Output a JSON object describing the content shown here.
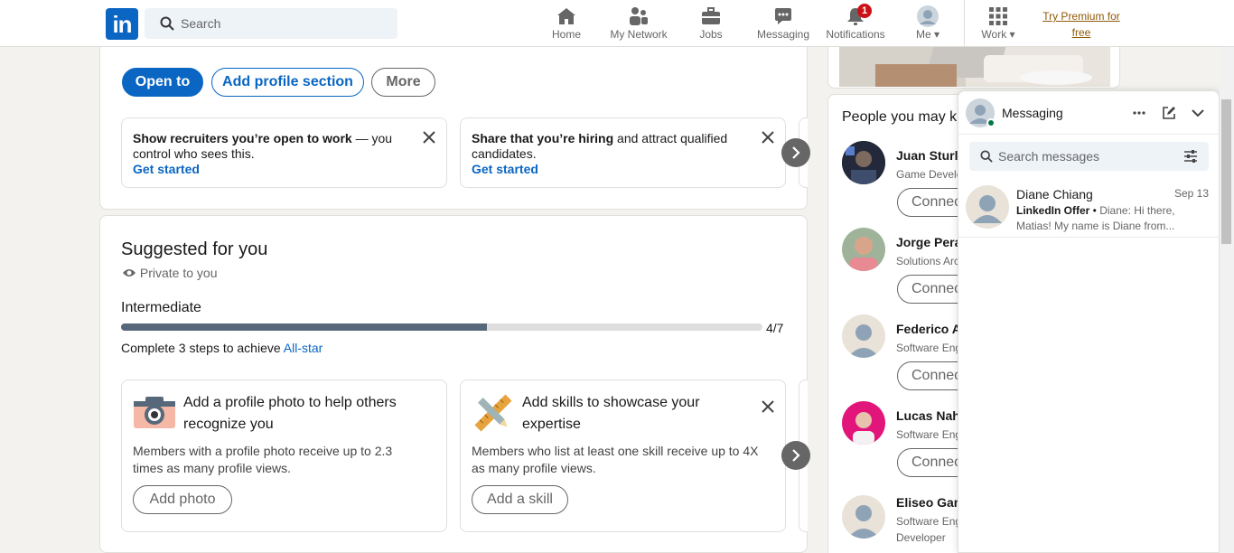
{
  "nav": {
    "logo_text": "in",
    "search_placeholder": "Search",
    "items": [
      {
        "label": "Home",
        "icon": "home-icon"
      },
      {
        "label": "My Network",
        "icon": "network-icon"
      },
      {
        "label": "Jobs",
        "icon": "briefcase-icon"
      },
      {
        "label": "Messaging",
        "icon": "chat-icon"
      },
      {
        "label": "Notifications",
        "icon": "bell-icon",
        "badge": "1"
      },
      {
        "label": "Me",
        "icon": "avatar"
      },
      {
        "label": "Work",
        "icon": "grid-icon"
      }
    ],
    "premium_line1": "Try Premium for",
    "premium_line2": "free"
  },
  "profile_actions": {
    "open_to": "Open to",
    "add_section": "Add profile section",
    "more": "More"
  },
  "open_cards": [
    {
      "bold": "Show recruiters you’re open to work",
      "rest": " — you control who sees this.",
      "link": "Get started"
    },
    {
      "bold": "Share that you’re hiring",
      "rest": " and attract qualified candidates.",
      "link": "Get started"
    }
  ],
  "suggested": {
    "title": "Suggested for you",
    "privacy": "Private to you",
    "level": "Intermediate",
    "progress": 0.57,
    "progress_label": "4/7",
    "complete_prefix": "Complete 3 steps to achieve ",
    "complete_link": "All-star",
    "cards": [
      {
        "title": "Add a profile photo to help others recognize you",
        "desc": "Members with a profile photo receive up to 2.3 times as many profile views.",
        "button": "Add photo",
        "icon": "camera-icon"
      },
      {
        "title": "Add skills to showcase your expertise",
        "desc": "Members who list at least one skill receive up to 4X as many profile views.",
        "button": "Add a skill",
        "icon": "ruler-pencil-icon"
      }
    ]
  },
  "pymk": {
    "title": "People you may k",
    "people": [
      {
        "name": "Juan Sturla",
        "title": "Game Develo",
        "button": "Connect"
      },
      {
        "name": "Jorge Peral",
        "title": "Solutions Arc",
        "button": "Connect"
      },
      {
        "name": "Federico A",
        "title": "Software Eng",
        "button": "Connect"
      },
      {
        "name": "Lucas Nahu",
        "title": "Software Eng",
        "button": "Connect"
      },
      {
        "name": "Eliseo Gam",
        "title": "Software Eng",
        "title2": "Developer",
        "button": "Connect"
      }
    ]
  },
  "messaging": {
    "title": "Messaging",
    "search_placeholder": "Search messages",
    "conversations": [
      {
        "name": "Diane Chiang",
        "date": "Sep 13",
        "sender": "LinkedIn Offer",
        "separator": " • ",
        "preview": "Diane: Hi there, Matias! My name is Diane from..."
      }
    ]
  },
  "colors": {
    "brand": "#0a66c2",
    "badge": "#cc1016",
    "premium": "#915907",
    "online": "#057642"
  }
}
